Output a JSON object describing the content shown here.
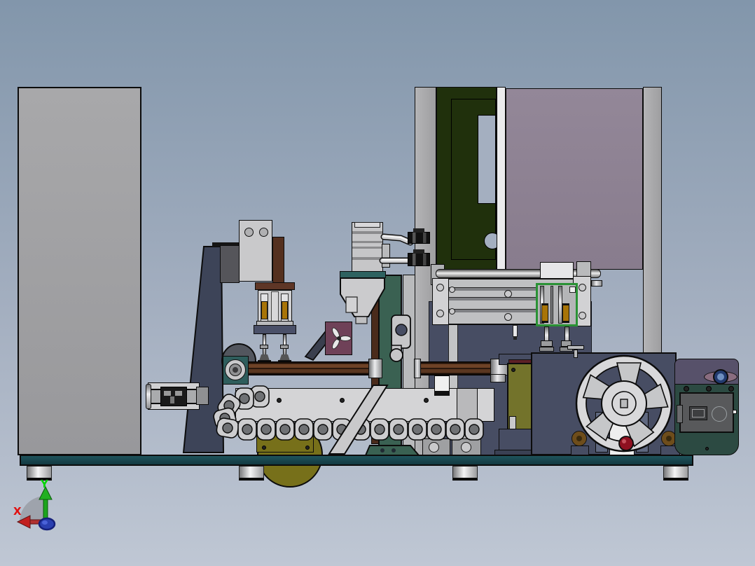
{
  "viewport": {
    "description": "3D CAD shaded model view of an automated packing machine assembly, side elevation",
    "triad": {
      "x_label": "X",
      "y_label": "Y"
    }
  },
  "colors": {
    "bg_top": "#8296ab",
    "bg_mid": "#a4afc0",
    "bg_bottom": "#bfc7d4",
    "outline": "#0c0c0c",
    "cabinet": "#a0a0a2",
    "column": "#a9a9ab",
    "panel_green": "#20300c",
    "panel_white": "#ebebec",
    "panel_mauve": "#8e8292",
    "navy": "#474d63",
    "stand_navy": "#3d4458",
    "column_green": "#3a6152",
    "rail_brown": "#6e4226",
    "plate_brown": "#5e3626",
    "olive": "#77701a",
    "olive_box": "#73732b",
    "maroon": "#6f4158",
    "amber": "#a87408",
    "brass": "#6e4d1b",
    "body_gray": "#c9c9cb",
    "wheel_face": "#d8d8da",
    "knob_red": "#8e1020",
    "ctrl_top": "#57516a",
    "ctrl_body": "#2c4a42",
    "ctrl_panel": "#58595b",
    "carriage_green": "#2a9235",
    "chain": "#cdcdcf",
    "chain_hole": "#6f7174",
    "base_teal": "#19474f",
    "steel_blue": "#5f6880",
    "axis_red": "#c22020",
    "axis_green": "#18a018",
    "axis_blue": "#2a3fb0"
  }
}
